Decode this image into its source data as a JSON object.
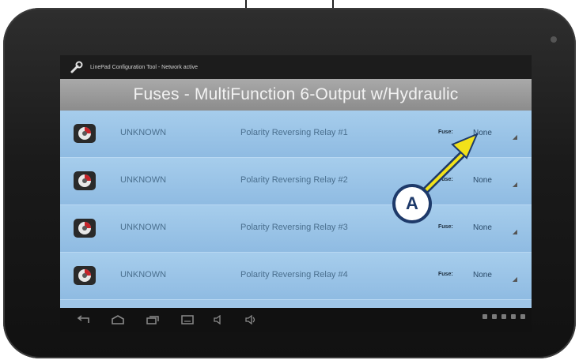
{
  "window": {
    "title": "LinePad Configuration Tool - Network active"
  },
  "header": {
    "title": "Fuses - MultiFunction 6-Output w/Hydraulic"
  },
  "rows": [
    {
      "status": "UNKNOWN",
      "name": "Polarity Reversing Relay #1",
      "fuse_label": "Fuse:",
      "fuse_value": "None"
    },
    {
      "status": "UNKNOWN",
      "name": "Polarity Reversing Relay #2",
      "fuse_label": "Fuse:",
      "fuse_value": "None"
    },
    {
      "status": "UNKNOWN",
      "name": "Polarity Reversing Relay #3",
      "fuse_label": "Fuse:",
      "fuse_value": "None"
    },
    {
      "status": "UNKNOWN",
      "name": "Polarity Reversing Relay #4",
      "fuse_label": "Fuse:",
      "fuse_value": "None"
    }
  ],
  "callout": {
    "label": "A",
    "color": "#1e3a6a",
    "arrow_color": "#f2e21a"
  },
  "navbar": {
    "buttons": [
      "back-icon",
      "home-icon",
      "recent-apps-icon",
      "screenshot-icon",
      "volume-down-icon",
      "volume-up-icon"
    ]
  },
  "colors": {
    "row_background": "#9fc6e8",
    "header_background": "#9a9a9a",
    "titlebar_background": "#1c1c1c"
  }
}
